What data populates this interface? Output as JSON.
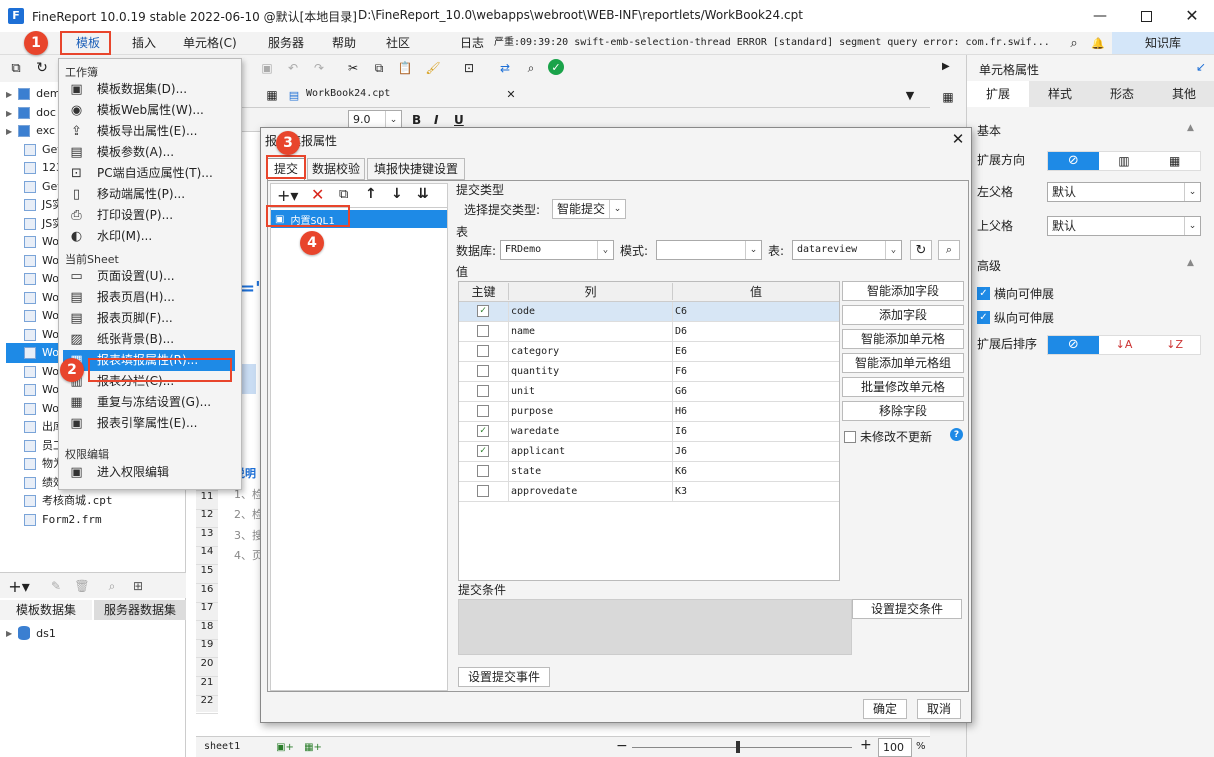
{
  "window": {
    "title": "FineReport 10.0.19 stable 2022-06-10 @默认[本地目录]",
    "path": "D:\\FineReport_10.0\\webapps\\webroot\\WEB-INF\\reportlets/WorkBook24.cpt"
  },
  "menubar": {
    "items": [
      "模板",
      "插入",
      "单元格(C)",
      "服务器",
      "帮助",
      "社区"
    ],
    "log_label": "日志",
    "log_text": "严重:09:39:20 swift-emb-selection-thread ERROR [standard] segment query error: com.fr.swif...",
    "kb_label": "知识库"
  },
  "tree": {
    "items": [
      "dem",
      "doc",
      "exc",
      "Get",
      "123",
      "Get",
      "JS实",
      "JS实",
      "Wor",
      "Wor",
      "Wor",
      "Wor",
      "Wor",
      "Wor",
      "Wor",
      "Wor",
      "Wor",
      "Wor",
      "出库",
      "员工",
      "物为",
      "绩效",
      "考核商城.cpt",
      "Form2.frm"
    ]
  },
  "ds_panel": {
    "tabs": [
      "模板数据集",
      "服务器数据集"
    ],
    "items": [
      "ds1"
    ]
  },
  "sheet": {
    "tab": "WorkBook24.cpt",
    "font_size": "9.0",
    "rows": [
      "10",
      "11",
      "12",
      "13",
      "14",
      "15",
      "16",
      "17",
      "18",
      "19",
      "20",
      "21",
      "22"
    ],
    "cell_texts": [
      "说明",
      "1、检",
      "2、检",
      "3、搜",
      "4、页"
    ],
    "sheet_tab": "sheet1",
    "zoom": "100",
    "zoom_unit": "%"
  },
  "dropdown": {
    "sec_workbook": "工作簿",
    "workbook_items": [
      "模板数据集(D)...",
      "模板Web属性(W)...",
      "模板导出属性(E)...",
      "模板参数(A)...",
      "PC端自适应属性(T)...",
      "移动端属性(P)...",
      "打印设置(P)...",
      "水印(M)..."
    ],
    "sec_sheet": "当前Sheet",
    "sheet_items": [
      "页面设置(U)...",
      "报表页眉(H)...",
      "报表页脚(F)...",
      "纸张背景(B)...",
      "报表填报属性(R)...",
      "报表分栏(C)...",
      "重复与冻结设置(G)...",
      "报表引擎属性(E)..."
    ],
    "sec_perm": "权限编辑",
    "perm_items": [
      "进入权限编辑"
    ]
  },
  "dialog": {
    "title": "报表填报属性",
    "tabs": [
      "提交",
      "数据校验",
      "填报快捷键设置"
    ],
    "submit_list": [
      "内置SQL1"
    ],
    "submit_type_header": "提交类型",
    "choose_type_label": "选择提交类型:",
    "submit_type_value": "智能提交",
    "table_header": "表",
    "db_label": "数据库:",
    "db_value": "FRDemo",
    "schema_label": "模式:",
    "schema_value": "",
    "table_label": "表:",
    "table_value": "datareview",
    "value_header": "值",
    "grid_headers": [
      "主键",
      "列",
      "值"
    ],
    "grid_rows": [
      {
        "key": true,
        "col": "code",
        "val": "C6"
      },
      {
        "key": false,
        "col": "name",
        "val": "D6"
      },
      {
        "key": false,
        "col": "category",
        "val": "E6"
      },
      {
        "key": false,
        "col": "quantity",
        "val": "F6"
      },
      {
        "key": false,
        "col": "unit",
        "val": "G6"
      },
      {
        "key": false,
        "col": "purpose",
        "val": "H6"
      },
      {
        "key": true,
        "col": "waredate",
        "val": "I6"
      },
      {
        "key": true,
        "col": "applicant",
        "val": "J6"
      },
      {
        "key": false,
        "col": "state",
        "val": "K6"
      },
      {
        "key": false,
        "col": "approvedate",
        "val": "K3"
      }
    ],
    "side_buttons": [
      "智能添加字段",
      "添加字段",
      "智能添加单元格",
      "智能添加单元格组",
      "批量修改单元格",
      "移除字段"
    ],
    "unchanged_label": "未修改不更新",
    "condition_header": "提交条件",
    "set_condition": "设置提交条件",
    "set_event": "设置提交事件",
    "ok": "确定",
    "cancel": "取消"
  },
  "rpanel": {
    "title": "单元格属性",
    "tabs": [
      "扩展",
      "样式",
      "形态",
      "其他"
    ],
    "basic": "基本",
    "direction_label": "扩展方向",
    "left_parent_label": "左父格",
    "left_parent_value": "默认",
    "top_parent_label": "上父格",
    "top_parent_value": "默认",
    "advanced": "高级",
    "h_expand": "横向可伸展",
    "v_expand": "纵向可伸展",
    "sort_label": "扩展后排序"
  },
  "badges": [
    "1",
    "2",
    "3",
    "4"
  ]
}
